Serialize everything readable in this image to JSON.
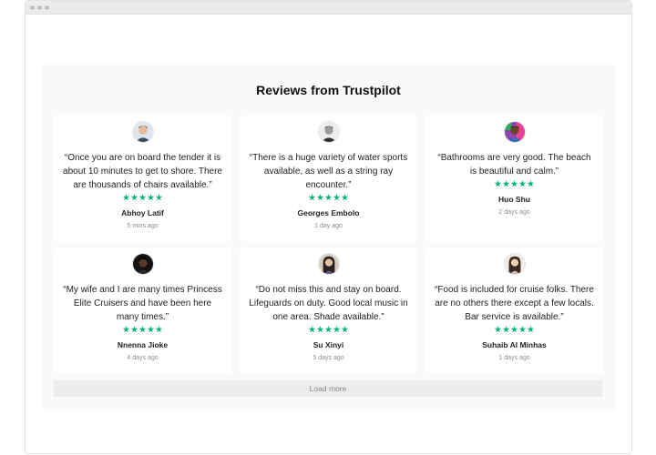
{
  "widget": {
    "title": "Reviews from Trustpilot",
    "load_more_label": "Load more",
    "star_color": "#00b67a",
    "reviews": [
      {
        "text": "“Once you are on board the tender it is about 10 minutes to get to shore. There are thousands of chairs available.”",
        "author": "Abhoy Latif",
        "time": "5 mins ago",
        "rating": 5,
        "avatar": "man-short-hair-avatar"
      },
      {
        "text": "“There is a huge variety of water sports available, as well as a string ray encounter.”",
        "author": "Georges Embolo",
        "time": "1 day ago",
        "rating": 5,
        "avatar": "man-grayscale-avatar"
      },
      {
        "text": "“Bathrooms are very good. The beach is beautiful and calm.”",
        "author": "Huo Shu",
        "time": "2 days ago",
        "rating": 5,
        "avatar": "man-colorful-background-avatar"
      },
      {
        "text": "“My wife and I are many times Princess Elite Cruisers and have been here many times.”",
        "author": "Nnenna Jioke",
        "time": "4 days ago",
        "rating": 5,
        "avatar": "woman-dark-background-avatar"
      },
      {
        "text": "“Do not miss this and stay on board. Lifeguards on duty. Good local music in one area. Shade available.”",
        "author": "Su Xinyi",
        "time": "5 days ago",
        "rating": 5,
        "avatar": "woman-long-hair-avatar"
      },
      {
        "text": "“Food is included for cruise folks. There are no others there except a few locals. Bar service is available.”",
        "author": "Suhaib Al Minhas",
        "time": "1 days ago",
        "rating": 5,
        "avatar": "woman-light-background-avatar"
      }
    ]
  }
}
